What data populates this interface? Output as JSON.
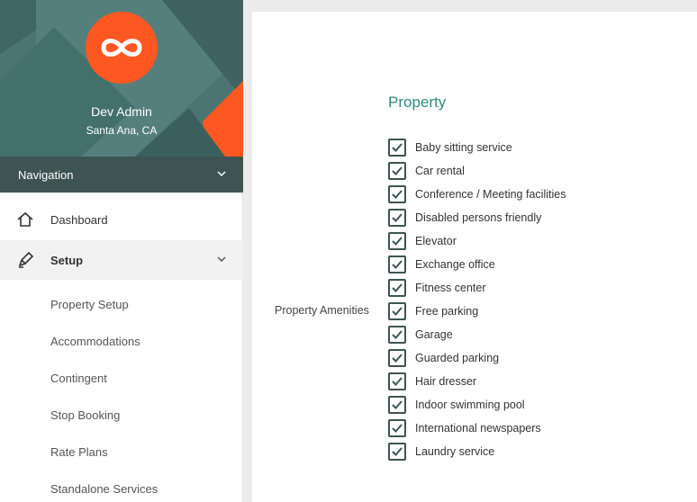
{
  "profile": {
    "name": "Dev Admin",
    "location": "Santa Ana, CA",
    "logo_icon": "infinity-icon",
    "accent_color": "#ff5722"
  },
  "navigation": {
    "header": "Navigation",
    "items": [
      {
        "label": "Dashboard",
        "icon": "home-icon"
      },
      {
        "label": "Setup",
        "icon": "pen-icon",
        "expanded": true
      }
    ],
    "setup_subitems": [
      "Property Setup",
      "Accommodations",
      "Contingent",
      "Stop Booking",
      "Rate Plans",
      "Standalone Services"
    ]
  },
  "main": {
    "section_title": "Property",
    "amenities_label": "Property Amenities",
    "amenities": [
      "Baby sitting service",
      "Car rental",
      "Conference / Meeting facilities",
      "Disabled persons friendly",
      "Elevator",
      "Exchange office",
      "Fitness center",
      "Free parking",
      "Garage",
      "Guarded parking",
      "Hair dresser",
      "Indoor swimming pool",
      "International newspapers",
      "Laundry service"
    ],
    "amenities_checked": [
      true,
      true,
      true,
      true,
      true,
      true,
      true,
      true,
      true,
      true,
      true,
      true,
      true,
      true
    ]
  }
}
